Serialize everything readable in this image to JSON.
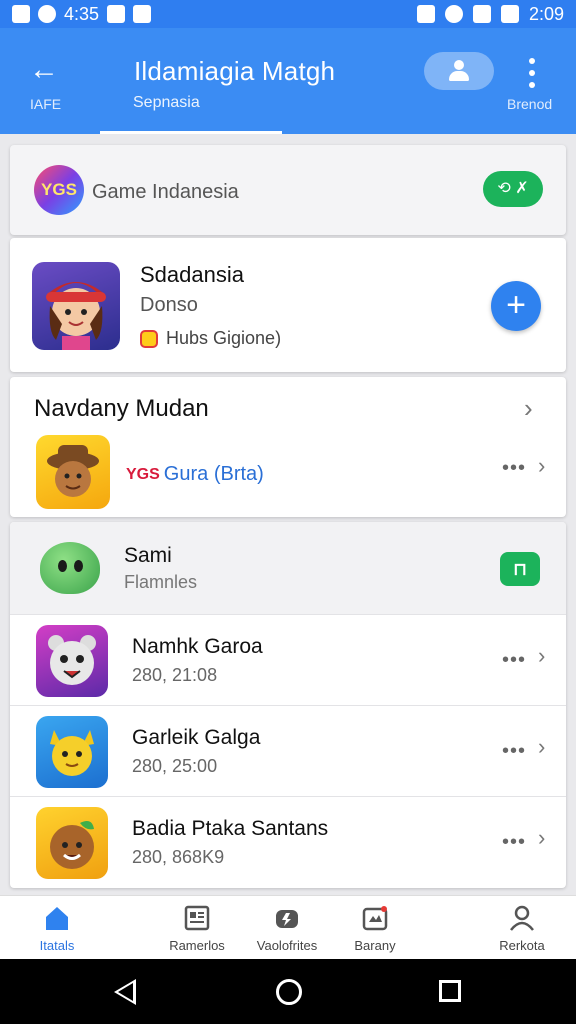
{
  "status_bar": {
    "time_left": "4:35",
    "time_right": "2:09"
  },
  "app_bar": {
    "back_label": "IAFE",
    "title": "Ildamiagia Matgh",
    "active_tab": "Sepnasia",
    "more_label": "Brenod"
  },
  "featured": {
    "logo_text": "YGS",
    "label": "Game Indanesia",
    "badge": "🟢 ✗"
  },
  "highlight_app": {
    "title": "Sdadansia",
    "subtitle": "Donso",
    "tag": "Hubs Gigione)"
  },
  "section": {
    "heading": "Navdany Mudan",
    "tag_red": "YGS",
    "tag_blue": "Gura (Brta)"
  },
  "list_header": {
    "name": "Sami",
    "sub": "Flamnles"
  },
  "list": [
    {
      "name": "Namhk Garoa",
      "meta": "280, 21:08"
    },
    {
      "name": "Garleik Galga",
      "meta": "280, 25:00"
    },
    {
      "name": "Badia Ptaka Santans",
      "meta": "280, 868K9"
    }
  ],
  "bottom_nav": [
    {
      "label": "Itatals"
    },
    {
      "label": "Ramerlos"
    },
    {
      "label": "Vaolofrites"
    },
    {
      "label": "Barany"
    },
    {
      "label": "Rerkota"
    }
  ],
  "colors": {
    "primary": "#3b8cf3",
    "green": "#1cb35b",
    "accent_red": "#d81b3c"
  }
}
